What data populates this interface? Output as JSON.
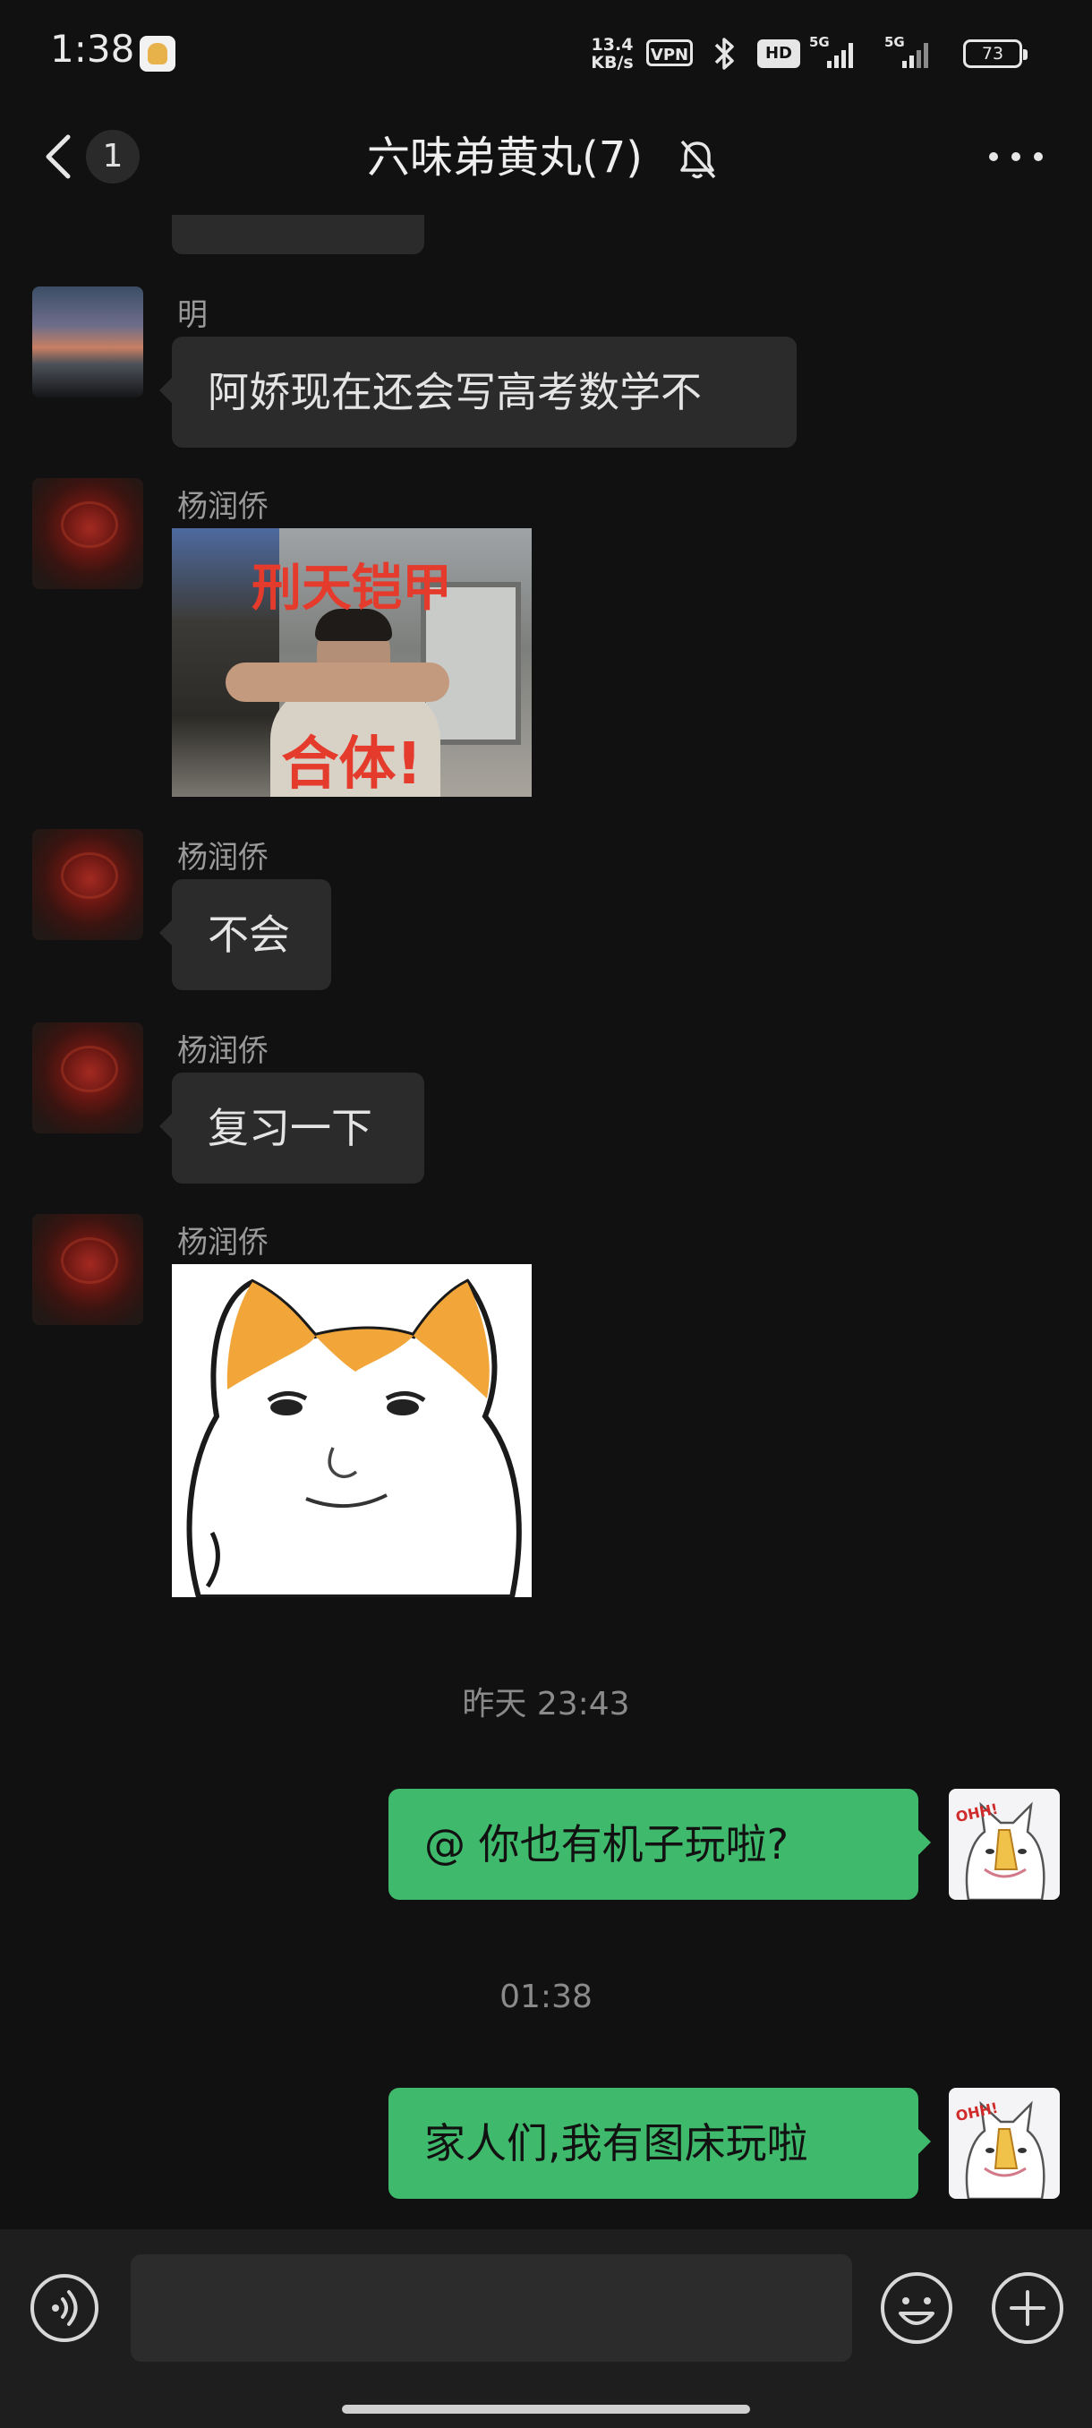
{
  "status_bar": {
    "time": "1:38",
    "net_speed_value": "13.4",
    "net_speed_unit": "KB/s",
    "vpn": "VPN",
    "hd_label": "HD",
    "network_1": "5G",
    "network_2": "5G",
    "battery": "73"
  },
  "header": {
    "back_count": "1",
    "title": "六味弟黄丸(7)"
  },
  "messages": [
    {
      "sender": "明",
      "text": "阿娇现在还会写高考数学不"
    },
    {
      "sender": "杨润侨",
      "image_text_top": "刑天铠甲",
      "image_text_bottom": "合体!"
    },
    {
      "sender": "杨润侨",
      "text": "不会"
    },
    {
      "sender": "杨润侨",
      "text": "复习一下"
    },
    {
      "sender": "杨润侨"
    }
  ],
  "timestamps": [
    "昨天 23:43",
    "01:38"
  ],
  "outgoing": [
    {
      "text": "@    你也有机子玩啦?"
    },
    {
      "text": "家人们,我有图床玩啦"
    }
  ],
  "sticker_text": "OHH!",
  "input": {
    "value": ""
  },
  "colors": {
    "background": "#111111",
    "incoming_bubble": "#2b2b2b",
    "outgoing_bubble": "#3fb96b",
    "meme_text": "#e43b2c"
  }
}
